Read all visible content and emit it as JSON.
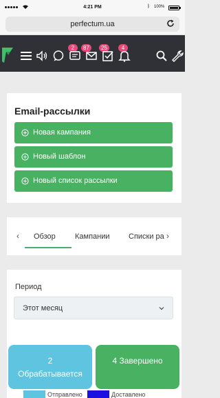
{
  "status_bar": {
    "time": "4:21 PM",
    "battery": "100%"
  },
  "browser": {
    "url": "perfectum.ua"
  },
  "header": {
    "badges": {
      "chat": "2",
      "mail": "87",
      "tasks": "25",
      "notifications": "4"
    }
  },
  "email_card": {
    "title": "Email-рассылки",
    "buttons": [
      {
        "label": "Новая кампания"
      },
      {
        "label": "Новый шаблон"
      },
      {
        "label": "Новый список рассылки"
      }
    ]
  },
  "tabs": {
    "items": [
      {
        "label": "Обзор"
      },
      {
        "label": "Кампании"
      },
      {
        "label": "Списки ра"
      }
    ],
    "active": "Обзор"
  },
  "period": {
    "label": "Период",
    "selected": "Этот месяц"
  },
  "stats": {
    "processing": {
      "count": "2",
      "label": "Обрабатывается"
    },
    "completed": {
      "label": "4 Завершено"
    }
  },
  "legend": [
    {
      "label": "Отправлено",
      "color": "#5ec4e0"
    },
    {
      "label": "Доставлено",
      "color": "#1a10e0"
    }
  ],
  "colors": {
    "accent_green": "#49b162",
    "header_bg": "#2f3136",
    "badge_pink": "#e6487a"
  }
}
